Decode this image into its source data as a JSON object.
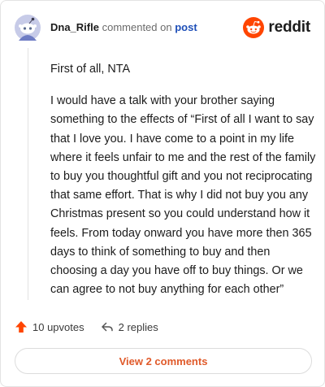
{
  "comment": {
    "author": "Dna_Rifle",
    "action_text": "commented on",
    "post_link": "post"
  },
  "brand": {
    "name": "reddit",
    "icon": "reddit-logo-icon",
    "accent_color": "#ff4500"
  },
  "body": {
    "paragraphs": [
      "First of all, NTA",
      "I would have a talk with your brother saying something to the effects of “First of all I want to say that I love you. I have come to a point in my life where it feels unfair to me and the rest of the family to buy you thoughtful gift and you not reciprocating that same effort. That is why I did not buy you any Christmas present so you could understand how it feels. From today onward you have more then 365 days to think of something to buy and then choosing a day you have off to buy things. Or we can agree to not buy anything for each other”"
    ]
  },
  "actions": {
    "upvotes_label": "10 upvotes",
    "upvote_icon": "upvote-arrow-icon",
    "replies_label": "2 replies",
    "reply_icon": "reply-icon"
  },
  "footer": {
    "view_comments_label": "View 2 comments",
    "view_comments_color": "#e05a2a"
  }
}
